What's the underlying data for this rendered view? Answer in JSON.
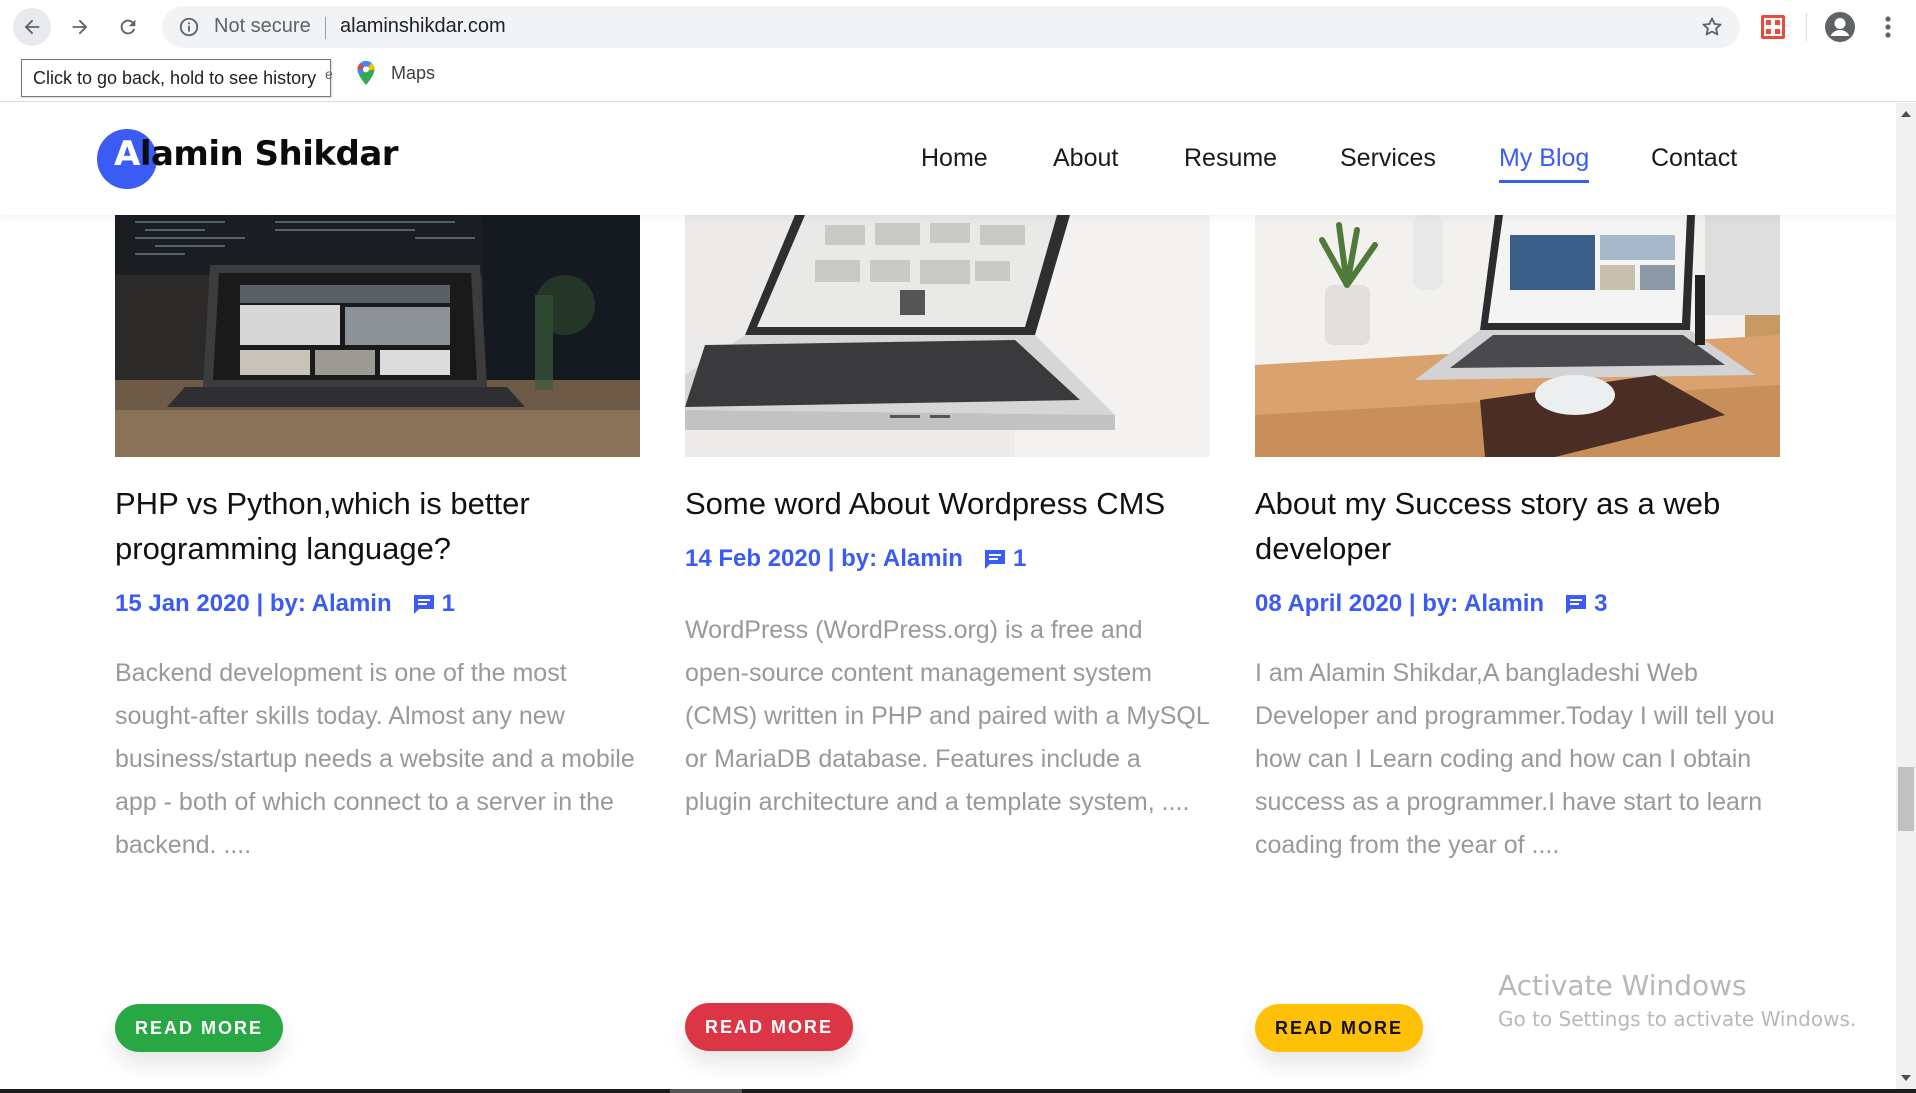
{
  "browser": {
    "security_label": "Not secure",
    "url": "alaminshikdar.com",
    "tooltip": "Click to go back, hold to see history",
    "bookmarks": [
      {
        "label": "Maps"
      }
    ]
  },
  "site": {
    "logo_first_letter": "A",
    "logo_rest": "lamin Shikdar",
    "accent_color": "#3a5cf4",
    "menu": [
      {
        "label": "Home",
        "active": false
      },
      {
        "label": "About",
        "active": false
      },
      {
        "label": "Resume",
        "active": false
      },
      {
        "label": "Services",
        "active": false
      },
      {
        "label": "My Blog",
        "active": true
      },
      {
        "label": "Contact",
        "active": false
      }
    ]
  },
  "posts": [
    {
      "title": "PHP vs Python,which is better programming language?",
      "date": "15 Jan 2020",
      "author_label": "| by: Alamin",
      "comments": "1",
      "excerpt": "Backend development is one of the most sought-after skills today. Almost any new business/startup needs a website and a mobile app - both of which connect to a server in the backend. ....",
      "button_label": "READ MORE",
      "button_color": "#28a745"
    },
    {
      "title": "Some word About Wordpress CMS",
      "date": "14 Feb 2020",
      "author_label": "| by: Alamin",
      "comments": "1",
      "excerpt": "WordPress (WordPress.org) is a free and open-source content management system (CMS) written in PHP and paired with a MySQL or MariaDB database. Features include a plugin architecture and a template system, ....",
      "button_label": "READ MORE",
      "button_color": "#dc3545"
    },
    {
      "title": "About my Success story as a web developer",
      "date": "08 April 2020",
      "author_label": "| by: Alamin",
      "comments": "3",
      "excerpt": "I am Alamin Shikdar,A bangladeshi Web Developer and programmer.Today I will tell you how can I Learn coding and how can I obtain success as a programmer.I have start to learn coading from the year of ....",
      "button_label": "READ MORE",
      "button_color": "#ffc107"
    }
  ],
  "watermark": {
    "title": "Activate Windows",
    "subtitle": "Go to Settings to activate Windows."
  }
}
